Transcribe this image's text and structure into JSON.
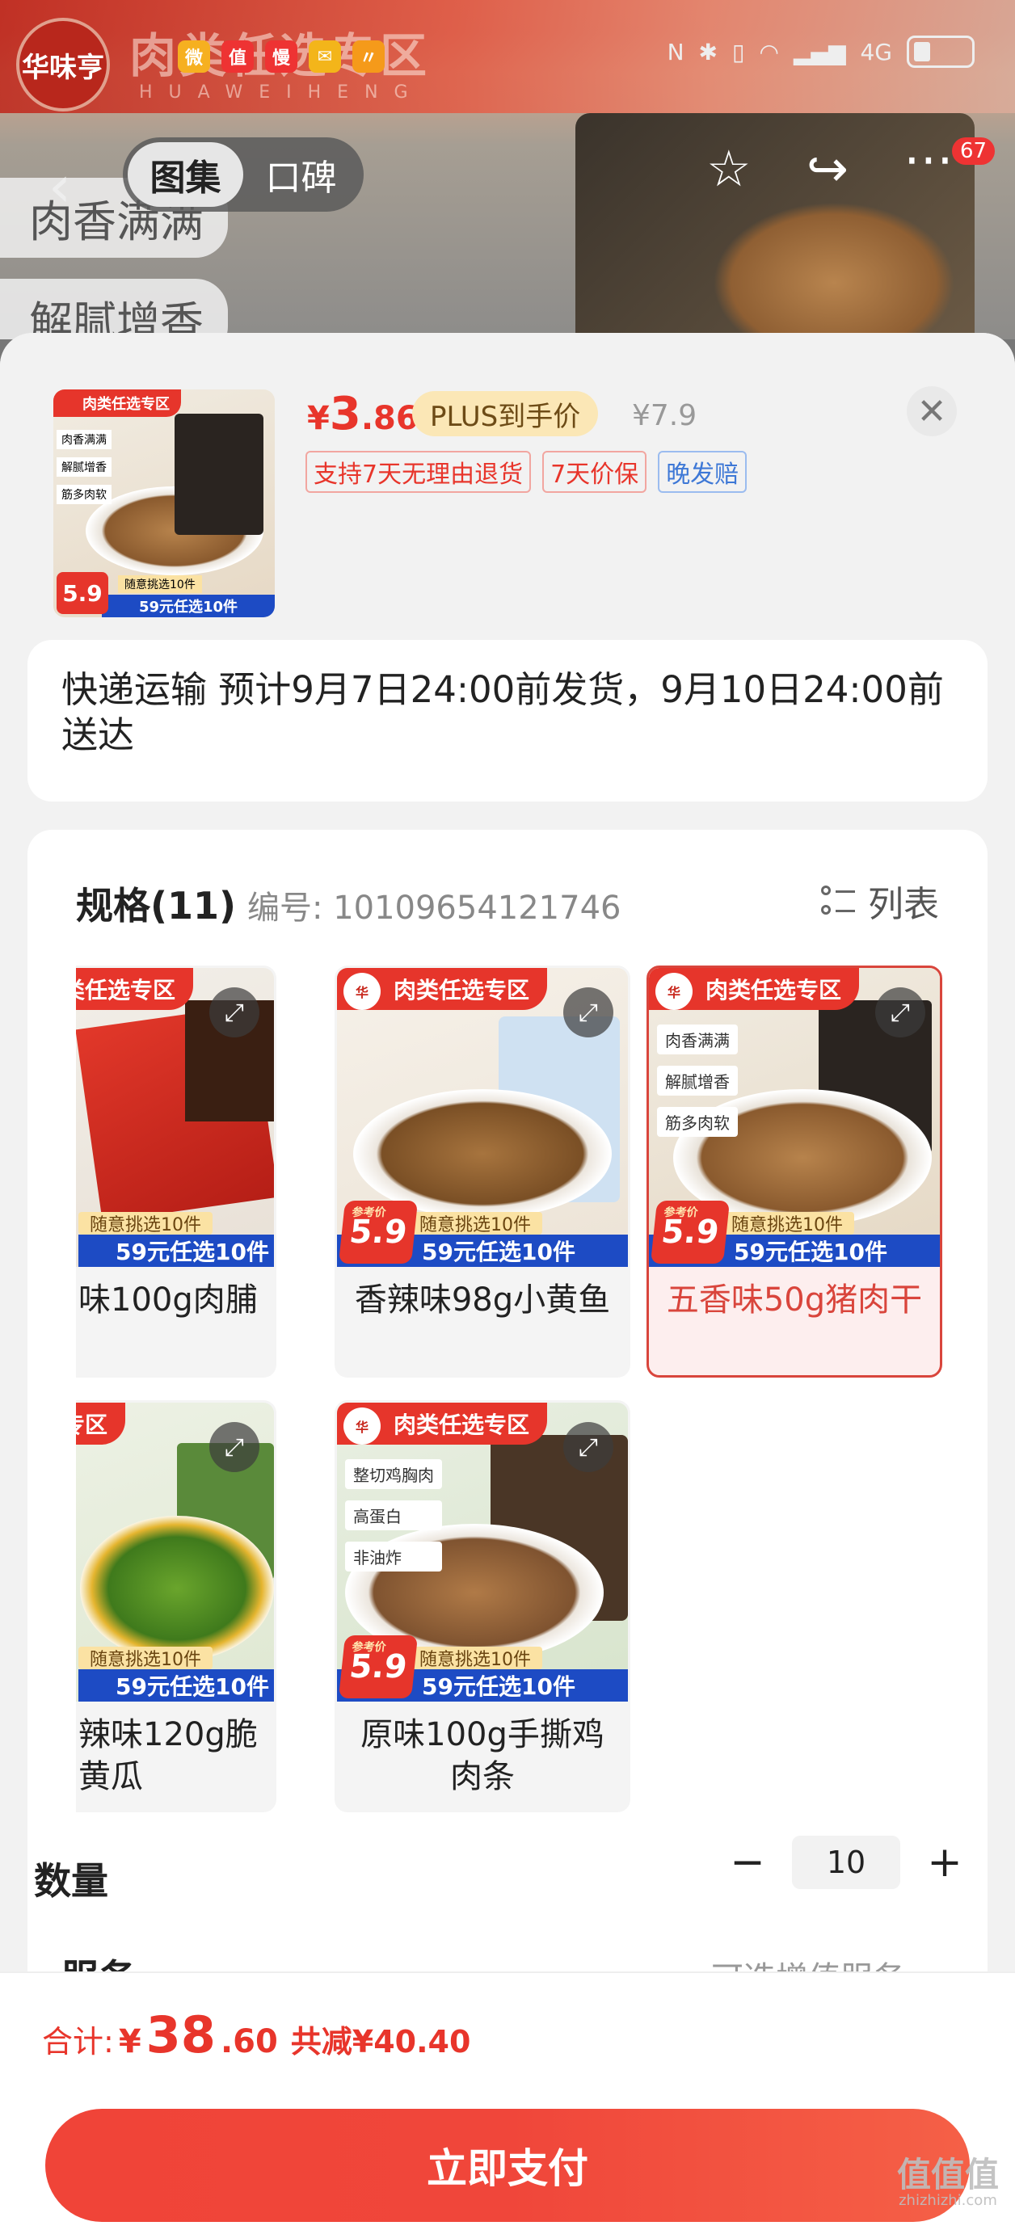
{
  "background": {
    "brand_text": "肉类任选专区",
    "brand_sub": "HUAWEIHENG",
    "logo_text": "华味亨",
    "status_apps": [
      "微",
      "值",
      "慢",
      "✉",
      "〃"
    ],
    "status_time_hint": "1",
    "status_net": "4G",
    "tags": [
      "肉香满满",
      "解腻增香"
    ],
    "segment": {
      "tab1": "图集",
      "tab2": "口碑"
    },
    "more_badge": "67"
  },
  "header": {
    "price_currency": "¥",
    "price_int": "3",
    "price_dec": ".86",
    "plus_label": "PLUS到手价",
    "original_price": "¥7.9",
    "tags": [
      "支持7天无理由退货",
      "7天价保",
      "晚发赔"
    ]
  },
  "thumb": {
    "pill": "肉类任选专区",
    "chips": [
      "肉香满满",
      "解腻增香",
      "筋多肉软"
    ],
    "ref_price": "5.9",
    "band_top": "随意挑选10件",
    "band_bottom": "59元任选10件"
  },
  "shipping": {
    "text": "快递运输 预计9月7日24:00前发货，9月10日24:00前送达"
  },
  "spec": {
    "title": "规格(11)",
    "number_label": "编号: 10109654121746",
    "list_label": "列表",
    "options": [
      {
        "label": "味100g肉脯"
      },
      {
        "label": "香辣味98g小黄鱼"
      },
      {
        "label": "五香味50g猪肉干"
      },
      {
        "label": "辣味120g脆黄瓜"
      },
      {
        "label": "原味100g手撕鸡肉条"
      }
    ],
    "promo": {
      "pill": "肉类任选专区",
      "pill_partial": "选专区",
      "ref": "参考价",
      "price": "5.9",
      "band_top": "随意挑选10件",
      "band_bottom": "59元任选10件",
      "chips3": [
        "肉香满满",
        "解腻增香",
        "筋多肉软"
      ],
      "chips5": [
        "整切鸡胸肉",
        "高蛋白",
        "非油炸"
      ]
    }
  },
  "quantity": {
    "label": "数量",
    "value": "10",
    "minus": "−",
    "plus": "+"
  },
  "partial_row": {
    "left": "服务",
    "right": "可选增值服务 ›"
  },
  "footer": {
    "total_label": "合计:",
    "currency": "¥",
    "total_int": "38",
    "total_dec": ".60",
    "discount": "共减¥40.40",
    "pay_label": "立即支付"
  },
  "watermark": {
    "main": "值值值",
    "sub": "zhizhizhi.com"
  },
  "colors": {
    "accent": "#e8352b",
    "plus_bg": "#fbe7b6",
    "blue_band": "#1d4bc4"
  }
}
